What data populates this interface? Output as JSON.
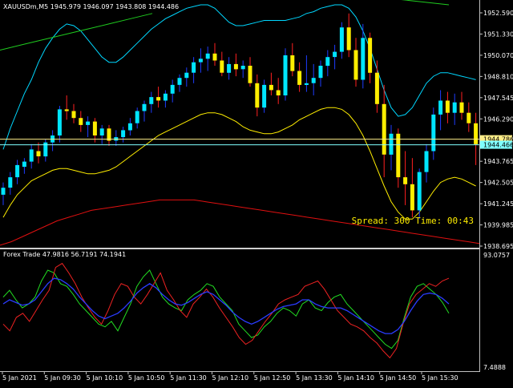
{
  "main_title": "XAUUSDm,M5  1945.979 1946.097 1943.808 1944.486",
  "sub_title": "Forex Trade 47.9816 56.7191 74.1941",
  "spread_label": "Spread: 300 Time: 00:43",
  "price_axis": {
    "ticks": [
      "1952.590",
      "1951.330",
      "1950.070",
      "1948.810",
      "1947.545",
      "1946.290",
      "1945.030",
      "1943.765",
      "1942.505",
      "1941.245",
      "1939.985",
      "1938.695"
    ],
    "range": [
      1938.695,
      1952.59
    ],
    "bid_label": "1944.786",
    "ask_label": "1944.466",
    "bid_price": 1944.786,
    "ask_price": 1944.466
  },
  "sub_axis": {
    "ticks": [
      "93.0757",
      "7.4888"
    ],
    "range": [
      7.4888,
      93.0757
    ]
  },
  "time_axis": {
    "labels": [
      "5 Jan 2021",
      "5 Jan 09:30",
      "5 Jan 10:10",
      "5 Jan 10:50",
      "5 Jan 11:30",
      "5 Jan 12:10",
      "5 Jan 12:50",
      "5 Jan 13:30",
      "5 Jan 14:10",
      "5 Jan 14:50",
      "5 Jan 15:30"
    ]
  },
  "colors": {
    "background": "#000000",
    "bull_candle": "#00e5ff",
    "bear_candle": "#ffee00",
    "bull_wick": "#1e3cff",
    "bear_wick": "#ff2020",
    "upper_band": "#00d7ff",
    "mid_band": "#ffee00",
    "outer_green": "#1fcc1f",
    "outer_red": "#e01010",
    "osc_green": "#22dd22",
    "osc_red": "#ee2222",
    "osc_blue": "#2a3cff",
    "axis_text": "#ffffff",
    "spread_text": "#ffee00"
  },
  "chart_data": [
    {
      "type": "candlestick",
      "title": "XAUUSDm,M5  1945.979 1946.097 1943.808 1944.486",
      "ylim": [
        1938.695,
        1952.59
      ],
      "candles": [
        [
          1941.6,
          1942.3,
          1941.0,
          1942.0
        ],
        [
          1942.0,
          1942.9,
          1941.6,
          1942.6
        ],
        [
          1942.6,
          1943.6,
          1942.2,
          1943.3
        ],
        [
          1943.2,
          1943.7,
          1942.8,
          1943.5
        ],
        [
          1943.5,
          1944.5,
          1943.1,
          1944.2
        ],
        [
          1944.1,
          1944.6,
          1943.4,
          1943.8
        ],
        [
          1943.8,
          1944.8,
          1943.5,
          1944.6
        ],
        [
          1944.6,
          1945.3,
          1944.1,
          1945.0
        ],
        [
          1945.0,
          1946.7,
          1944.6,
          1946.5
        ],
        [
          1946.5,
          1947.3,
          1945.9,
          1946.4
        ],
        [
          1946.4,
          1946.8,
          1945.7,
          1946.0
        ],
        [
          1946.0,
          1946.4,
          1945.2,
          1945.6
        ],
        [
          1945.6,
          1946.1,
          1944.9,
          1945.8
        ],
        [
          1945.8,
          1946.0,
          1944.6,
          1945.0
        ],
        [
          1945.0,
          1945.6,
          1944.5,
          1945.4
        ],
        [
          1945.4,
          1945.6,
          1944.4,
          1944.7
        ],
        [
          1944.7,
          1945.3,
          1944.4,
          1944.9
        ],
        [
          1944.9,
          1945.5,
          1944.6,
          1945.3
        ],
        [
          1945.3,
          1946.0,
          1945.0,
          1945.7
        ],
        [
          1945.7,
          1946.6,
          1945.4,
          1946.4
        ],
        [
          1946.4,
          1947.0,
          1945.8,
          1946.8
        ],
        [
          1946.8,
          1947.5,
          1946.3,
          1947.2
        ],
        [
          1947.2,
          1947.8,
          1946.6,
          1947.0
        ],
        [
          1947.0,
          1947.6,
          1946.6,
          1947.4
        ],
        [
          1947.4,
          1948.2,
          1946.9,
          1947.9
        ],
        [
          1947.9,
          1948.5,
          1947.5,
          1948.3
        ],
        [
          1948.3,
          1948.9,
          1947.8,
          1948.6
        ],
        [
          1948.6,
          1949.5,
          1948.0,
          1949.2
        ],
        [
          1949.2,
          1950.0,
          1948.6,
          1949.4
        ],
        [
          1949.4,
          1950.1,
          1948.7,
          1949.7
        ],
        [
          1949.7,
          1950.3,
          1949.0,
          1949.3
        ],
        [
          1949.3,
          1949.8,
          1948.4,
          1948.6
        ],
        [
          1948.6,
          1949.5,
          1948.2,
          1949.1
        ],
        [
          1949.1,
          1949.7,
          1948.4,
          1948.8
        ],
        [
          1948.8,
          1949.3,
          1948.3,
          1949.0
        ],
        [
          1949.0,
          1949.5,
          1947.8,
          1948.0
        ],
        [
          1948.0,
          1948.5,
          1946.1,
          1946.6
        ],
        [
          1946.6,
          1948.2,
          1946.3,
          1947.9
        ],
        [
          1947.9,
          1948.6,
          1947.3,
          1947.6
        ],
        [
          1947.6,
          1948.3,
          1946.8,
          1947.3
        ],
        [
          1947.3,
          1950.0,
          1947.0,
          1949.6
        ],
        [
          1949.6,
          1950.3,
          1948.4,
          1948.7
        ],
        [
          1948.7,
          1949.2,
          1947.5,
          1947.9
        ],
        [
          1947.9,
          1949.6,
          1947.5,
          1948.0
        ],
        [
          1948.0,
          1949.1,
          1947.3,
          1948.3
        ],
        [
          1948.3,
          1949.3,
          1947.8,
          1949.0
        ],
        [
          1949.0,
          1949.9,
          1948.4,
          1949.5
        ],
        [
          1949.5,
          1950.2,
          1948.8,
          1949.8
        ],
        [
          1949.8,
          1951.5,
          1949.4,
          1951.2
        ],
        [
          1951.2,
          1952.0,
          1949.5,
          1949.9
        ],
        [
          1949.9,
          1950.6,
          1947.8,
          1948.2
        ],
        [
          1948.2,
          1951.4,
          1947.7,
          1950.6
        ],
        [
          1950.6,
          1950.9,
          1948.0,
          1948.6
        ],
        [
          1948.6,
          1949.3,
          1946.3,
          1946.8
        ],
        [
          1946.8,
          1947.9,
          1942.6,
          1943.9
        ],
        [
          1943.9,
          1945.6,
          1943.0,
          1945.1
        ],
        [
          1945.1,
          1945.4,
          1942.0,
          1942.6
        ],
        [
          1942.6,
          1944.1,
          1941.0,
          1942.2
        ],
        [
          1942.2,
          1943.7,
          1940.3,
          1940.7
        ],
        [
          1940.7,
          1943.1,
          1940.2,
          1942.9
        ],
        [
          1942.9,
          1944.5,
          1942.3,
          1944.1
        ],
        [
          1944.1,
          1946.6,
          1943.6,
          1946.2
        ],
        [
          1946.2,
          1947.6,
          1945.3,
          1947.0
        ],
        [
          1947.0,
          1947.5,
          1945.7,
          1946.3
        ],
        [
          1946.3,
          1947.4,
          1945.6,
          1946.9
        ],
        [
          1946.9,
          1947.5,
          1945.9,
          1946.3
        ],
        [
          1946.3,
          1946.9,
          1945.2,
          1945.7
        ],
        [
          1945.7,
          1946.3,
          1943.3,
          1944.5
        ]
      ],
      "upper_band": [
        1944.2,
        1945.4,
        1946.4,
        1947.4,
        1948.2,
        1949.2,
        1950.0,
        1950.6,
        1951.1,
        1951.4,
        1951.3,
        1951.0,
        1950.5,
        1950.0,
        1949.5,
        1949.2,
        1949.2,
        1949.5,
        1949.9,
        1950.3,
        1950.7,
        1951.1,
        1951.4,
        1951.7,
        1951.9,
        1952.1,
        1952.3,
        1952.4,
        1952.5,
        1952.5,
        1952.3,
        1951.9,
        1951.5,
        1951.3,
        1951.3,
        1951.4,
        1951.5,
        1951.6,
        1951.6,
        1951.6,
        1951.6,
        1951.7,
        1951.8,
        1952.0,
        1952.1,
        1952.3,
        1952.4,
        1952.5,
        1952.5,
        1952.3,
        1951.8,
        1951.0,
        1950.0,
        1948.8,
        1947.6,
        1946.6,
        1946.1,
        1946.2,
        1946.6,
        1947.3,
        1948.0,
        1948.4,
        1948.6,
        1948.6,
        1948.5,
        1948.4,
        1948.3,
        1948.2
      ],
      "mid_band": [
        1940.3,
        1941.0,
        1941.6,
        1942.0,
        1942.4,
        1942.6,
        1942.8,
        1943.0,
        1943.1,
        1943.1,
        1943.0,
        1942.9,
        1942.8,
        1942.8,
        1942.9,
        1943.0,
        1943.2,
        1943.5,
        1943.8,
        1944.1,
        1944.4,
        1944.7,
        1945.0,
        1945.2,
        1945.4,
        1945.6,
        1945.8,
        1946.0,
        1946.2,
        1946.3,
        1946.3,
        1946.2,
        1946.0,
        1945.8,
        1945.5,
        1945.3,
        1945.2,
        1945.1,
        1945.1,
        1945.2,
        1945.4,
        1945.6,
        1945.9,
        1946.1,
        1946.3,
        1946.5,
        1946.6,
        1946.6,
        1946.5,
        1946.2,
        1945.7,
        1945.0,
        1944.1,
        1943.1,
        1942.1,
        1941.2,
        1940.6,
        1940.2,
        1940.2,
        1940.6,
        1941.2,
        1941.8,
        1942.3,
        1942.5,
        1942.6,
        1942.5,
        1942.3,
        1942.1
      ],
      "lower_band": [
        1938.7,
        1938.9,
        1939.2,
        1939.5,
        1939.8,
        1940.1,
        1940.3,
        1940.5,
        1940.7,
        1940.8,
        1940.9,
        1941.0,
        1941.1,
        1941.2,
        1941.3,
        1941.3,
        1941.3,
        1941.3,
        1941.2,
        1941.1,
        1941.0,
        1940.9,
        1940.8,
        1940.7,
        1940.6,
        1940.5,
        1940.4,
        1940.3,
        1940.2,
        1940.1,
        1940.0,
        1939.9,
        1939.8,
        1939.7,
        1939.6,
        1939.5,
        1939.4,
        1939.3,
        1939.2,
        1939.1,
        1939.0,
        1938.9,
        1938.8
      ],
      "top_line": [
        1949.9,
        1950.2,
        1950.5,
        1950.8,
        1951.1,
        1951.4,
        1951.7,
        1952.0,
        1952.3,
        1952.6,
        1952.9
      ]
    },
    {
      "type": "line",
      "title": "Forex Trade 47.9816 56.7191 74.1941",
      "ylim": [
        7.4888,
        93.0757
      ],
      "series": [
        {
          "color": "green",
          "values": [
            60,
            65,
            58,
            52,
            55,
            60,
            72,
            80,
            78,
            70,
            68,
            62,
            55,
            50,
            45,
            40,
            38,
            42,
            35,
            45,
            55,
            68,
            75,
            80,
            70,
            60,
            55,
            52,
            50,
            58,
            62,
            65,
            70,
            68,
            60,
            55,
            50,
            40,
            35,
            30,
            32,
            38,
            42,
            48,
            52,
            50,
            46,
            55,
            58,
            52,
            50,
            56,
            60,
            62,
            55,
            50,
            45,
            40,
            35,
            30,
            25,
            22,
            28,
            45,
            60,
            68,
            70,
            66,
            62,
            56,
            48
          ]
        },
        {
          "color": "red",
          "values": [
            40,
            35,
            45,
            48,
            42,
            50,
            58,
            65,
            82,
            85,
            78,
            70,
            60,
            52,
            45,
            40,
            50,
            62,
            70,
            68,
            60,
            55,
            62,
            70,
            78,
            65,
            58,
            50,
            45,
            55,
            60,
            66,
            60,
            52,
            45,
            38,
            30,
            25,
            28,
            35,
            42,
            48,
            55,
            58,
            60,
            62,
            68,
            70,
            72,
            66,
            58,
            50,
            45,
            40,
            38,
            35,
            30,
            26,
            20,
            15,
            22,
            40,
            55,
            62,
            66,
            70,
            68,
            72,
            74
          ]
        },
        {
          "color": "blue",
          "values": [
            55,
            58,
            56,
            54,
            55,
            58,
            64,
            70,
            74,
            73,
            70,
            66,
            60,
            55,
            50,
            46,
            44,
            46,
            48,
            52,
            57,
            63,
            67,
            70,
            67,
            62,
            58,
            55,
            54,
            56,
            59,
            62,
            64,
            62,
            58,
            54,
            49,
            45,
            42,
            40,
            42,
            45,
            48,
            51,
            53,
            54,
            55,
            58,
            58,
            55,
            53,
            52,
            52,
            52,
            50,
            47,
            44,
            41,
            38,
            35,
            33,
            33,
            36,
            42,
            50,
            57,
            62,
            63,
            62,
            59,
            55
          ]
        }
      ]
    }
  ]
}
